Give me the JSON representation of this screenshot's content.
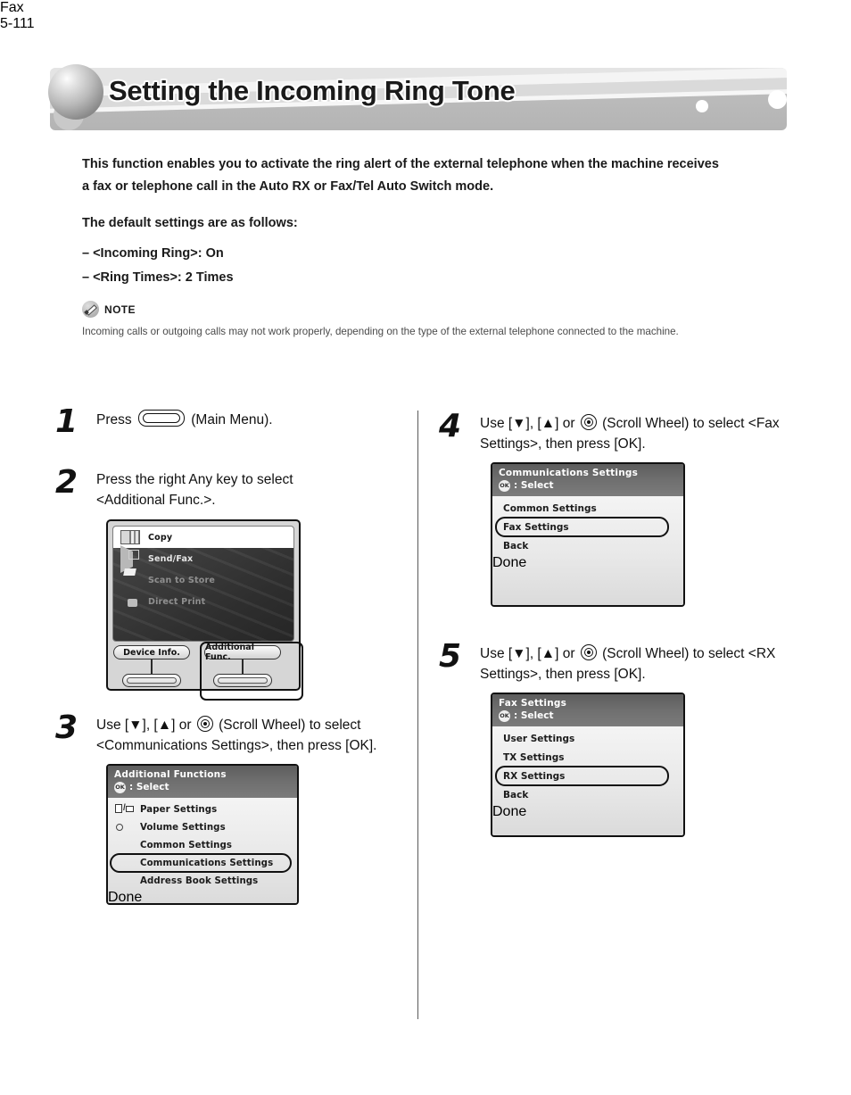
{
  "banner": {
    "title": "Setting the Incoming Ring Tone"
  },
  "intro": {
    "paragraph": "This function enables you to activate the ring alert of the external telephone when the machine receives a fax or telephone call in the Auto RX or Fax/Tel Auto Switch mode.",
    "defaults_heading": "The default settings are as follows:",
    "bullets": [
      "–  <Incoming Ring>: On",
      "–  <Ring Times>: 2 Times"
    ],
    "note_label": "NOTE",
    "note_body": "Incoming calls or outgoing calls may not work properly, depending on the type of the external telephone connected to the machine."
  },
  "steps": {
    "one": {
      "num": "1",
      "text_before": "Press",
      "text_after": "(Main Menu)."
    },
    "two": {
      "num": "2",
      "text": "Press the right Any key to select <Additional Func.>."
    },
    "three": {
      "num": "3",
      "text_before": "Use [▼], [▲] or",
      "text_after": "(Scroll Wheel) to select <Communications Settings>, then press [OK]."
    },
    "four": {
      "num": "4",
      "text_before": "Use [▼], [▲] or",
      "text_after": "(Scroll Wheel) to select <Fax Settings>, then press [OK]."
    },
    "five": {
      "num": "5",
      "text_before": "Use [▼], [▲] or",
      "text_after": "(Scroll Wheel) to select <RX Settings>, then press [OK]."
    }
  },
  "lcd_main_menu": {
    "rows": [
      {
        "label": "Copy",
        "icon": "copy-icon",
        "selected": true
      },
      {
        "label": "Send/Fax",
        "icon": "send-fax-icon",
        "selected": false
      },
      {
        "label": "Scan to Store",
        "icon": "scan-to-store-icon",
        "selected": false
      },
      {
        "label": "Direct Print",
        "icon": "direct-print-icon",
        "selected": false
      }
    ],
    "soft_left": "Device Info.",
    "soft_right": "Additional Func."
  },
  "lcd_additional_functions": {
    "title": "Additional Functions",
    "subtitle": ": Select",
    "ok_badge": "OK",
    "items": [
      {
        "label": "Paper Settings",
        "icon": "paper-settings-icon",
        "selected": false
      },
      {
        "label": "Volume Settings",
        "icon": "volume-settings-icon",
        "selected": false
      },
      {
        "label": "Common Settings",
        "icon": "common-settings-icon",
        "selected": false
      },
      {
        "label": "Communications Settings",
        "icon": "communications-settings-icon",
        "selected": true
      },
      {
        "label": "Address Book Settings",
        "icon": "address-book-settings-icon",
        "selected": false
      }
    ],
    "done": "Done"
  },
  "lcd_communications_settings": {
    "title": "Communications Settings",
    "subtitle": ": Select",
    "ok_badge": "OK",
    "items": [
      {
        "label": "Common Settings",
        "selected": false
      },
      {
        "label": "Fax Settings",
        "selected": true
      },
      {
        "label": "Back",
        "selected": false
      }
    ],
    "done": "Done"
  },
  "lcd_fax_settings": {
    "title": "Fax Settings",
    "subtitle": ": Select",
    "ok_badge": "OK",
    "items": [
      {
        "label": "User Settings",
        "selected": false
      },
      {
        "label": "TX Settings",
        "selected": false
      },
      {
        "label": "RX Settings",
        "selected": true
      },
      {
        "label": "Back",
        "selected": false
      }
    ],
    "done": "Done"
  },
  "side_tab": {
    "label": "Fax"
  },
  "footer": {
    "page_number": "5-111"
  }
}
